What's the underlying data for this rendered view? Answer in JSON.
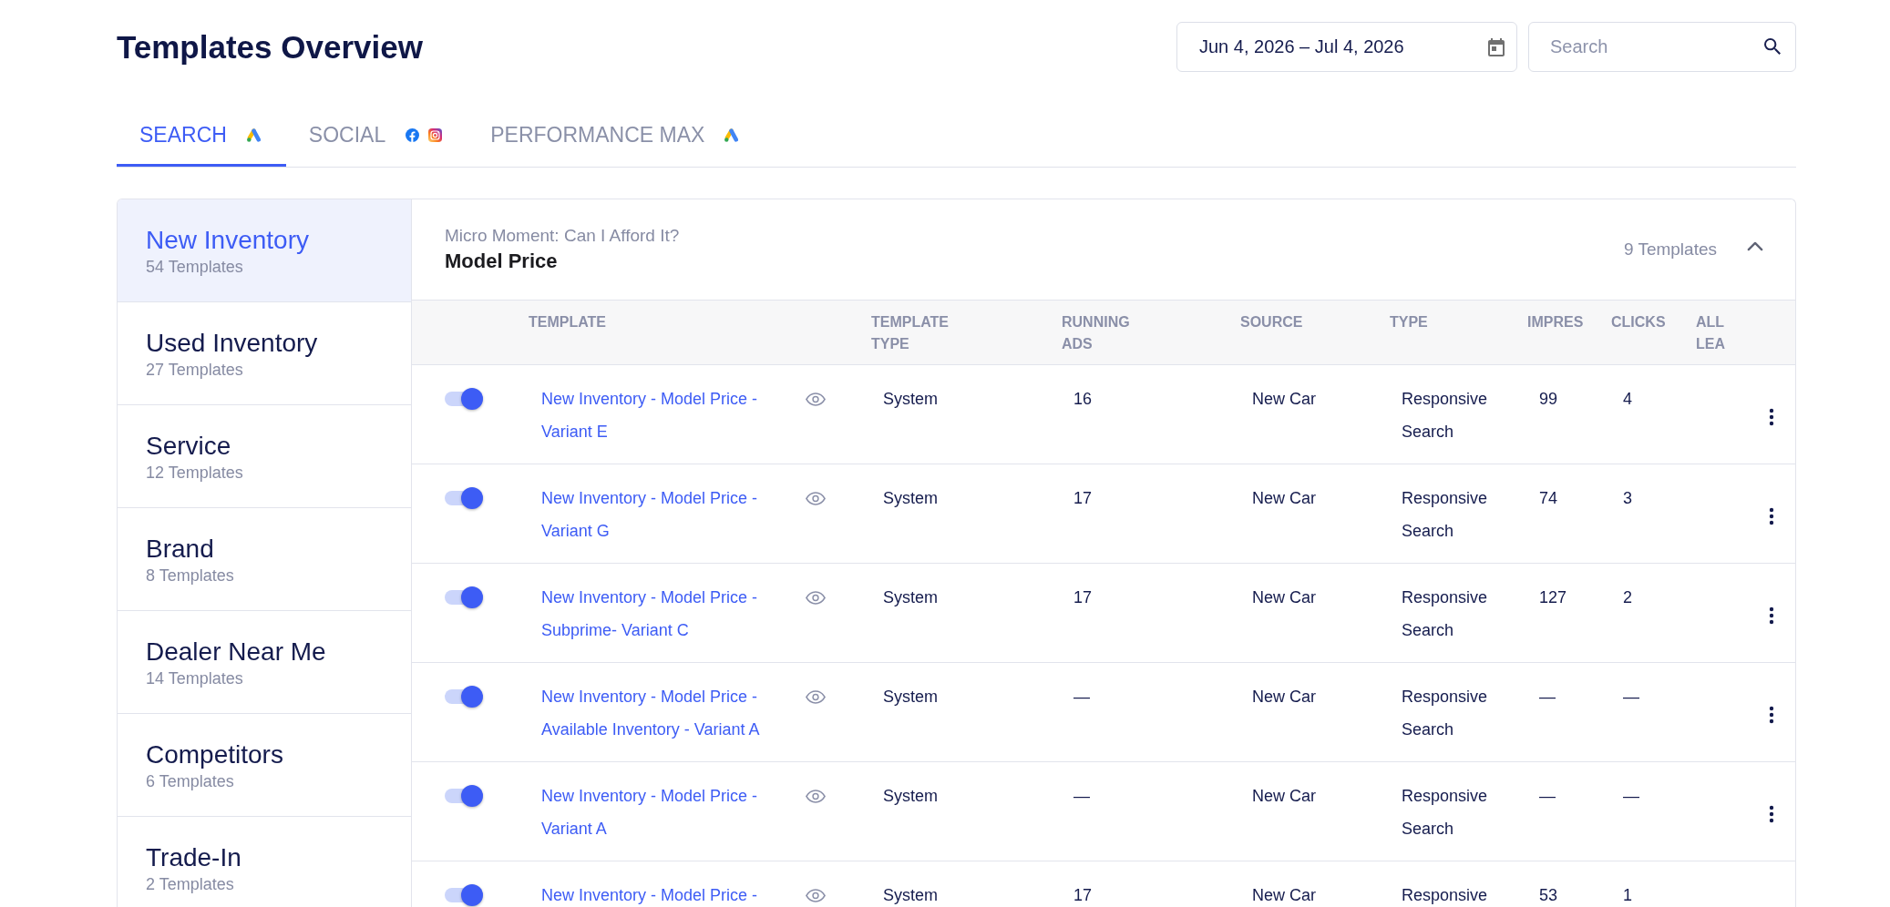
{
  "header": {
    "title": "Templates Overview",
    "date_range": {
      "value": "Jun 4, 2026 – Jul 4, 2026"
    },
    "search": {
      "placeholder": "Search"
    }
  },
  "tabs": [
    {
      "label": "SEARCH",
      "kind": "ads",
      "selected": true
    },
    {
      "label": "SOCIAL",
      "kind": "social",
      "selected": false
    },
    {
      "label": "PERFORMANCE MAX",
      "kind": "ads",
      "selected": false
    }
  ],
  "sidebar": {
    "items": [
      {
        "title": "New Inventory",
        "count": "54 Templates",
        "selected": true
      },
      {
        "title": "Used Inventory",
        "count": "27 Templates",
        "selected": false
      },
      {
        "title": "Service",
        "count": "12 Templates",
        "selected": false
      },
      {
        "title": "Brand",
        "count": "8 Templates",
        "selected": false
      },
      {
        "title": "Dealer Near Me",
        "count": "14 Templates",
        "selected": false
      },
      {
        "title": "Competitors",
        "count": "6 Templates",
        "selected": false
      },
      {
        "title": "Trade-In",
        "count": "2 Templates",
        "selected": false
      }
    ]
  },
  "group": {
    "subtitle": "Micro Moment: Can I Afford It?",
    "title": "Model Price",
    "count": "9 Templates",
    "expanded": true
  },
  "table": {
    "columns": [
      "TEMPLATE",
      "TEMPLATE TYPE",
      "RUNNING ADS",
      "SOURCE",
      "TYPE",
      "IMPRES",
      "CLICKS",
      "ALL LEA"
    ],
    "rows": [
      {
        "on": true,
        "template": "New Inventory - Model Price - Variant E",
        "template_type": "System",
        "running_ads": "16",
        "source": "New Car",
        "type": "Responsive Search",
        "impressions": "99",
        "clicks": "4"
      },
      {
        "on": true,
        "template": "New Inventory - Model Price - Variant G",
        "template_type": "System",
        "running_ads": "17",
        "source": "New Car",
        "type": "Responsive Search",
        "impressions": "74",
        "clicks": "3"
      },
      {
        "on": true,
        "template": "New Inventory - Model Price - Subprime- Variant C",
        "template_type": "System",
        "running_ads": "17",
        "source": "New Car",
        "type": "Responsive Search",
        "impressions": "127",
        "clicks": "2"
      },
      {
        "on": true,
        "template": "New Inventory - Model Price - Available Inventory - Variant A",
        "template_type": "System",
        "running_ads": "—",
        "source": "New Car",
        "type": "Responsive Search",
        "impressions": "—",
        "clicks": "—"
      },
      {
        "on": true,
        "template": "New Inventory - Model Price - Variant A",
        "template_type": "System",
        "running_ads": "—",
        "source": "New Car",
        "type": "Responsive Search",
        "impressions": "—",
        "clicks": "—"
      },
      {
        "on": true,
        "template": "New Inventory - Model Price -",
        "template_type": "System",
        "running_ads": "17",
        "source": "New Car",
        "type": "Responsive",
        "impressions": "53",
        "clicks": "1"
      }
    ]
  }
}
